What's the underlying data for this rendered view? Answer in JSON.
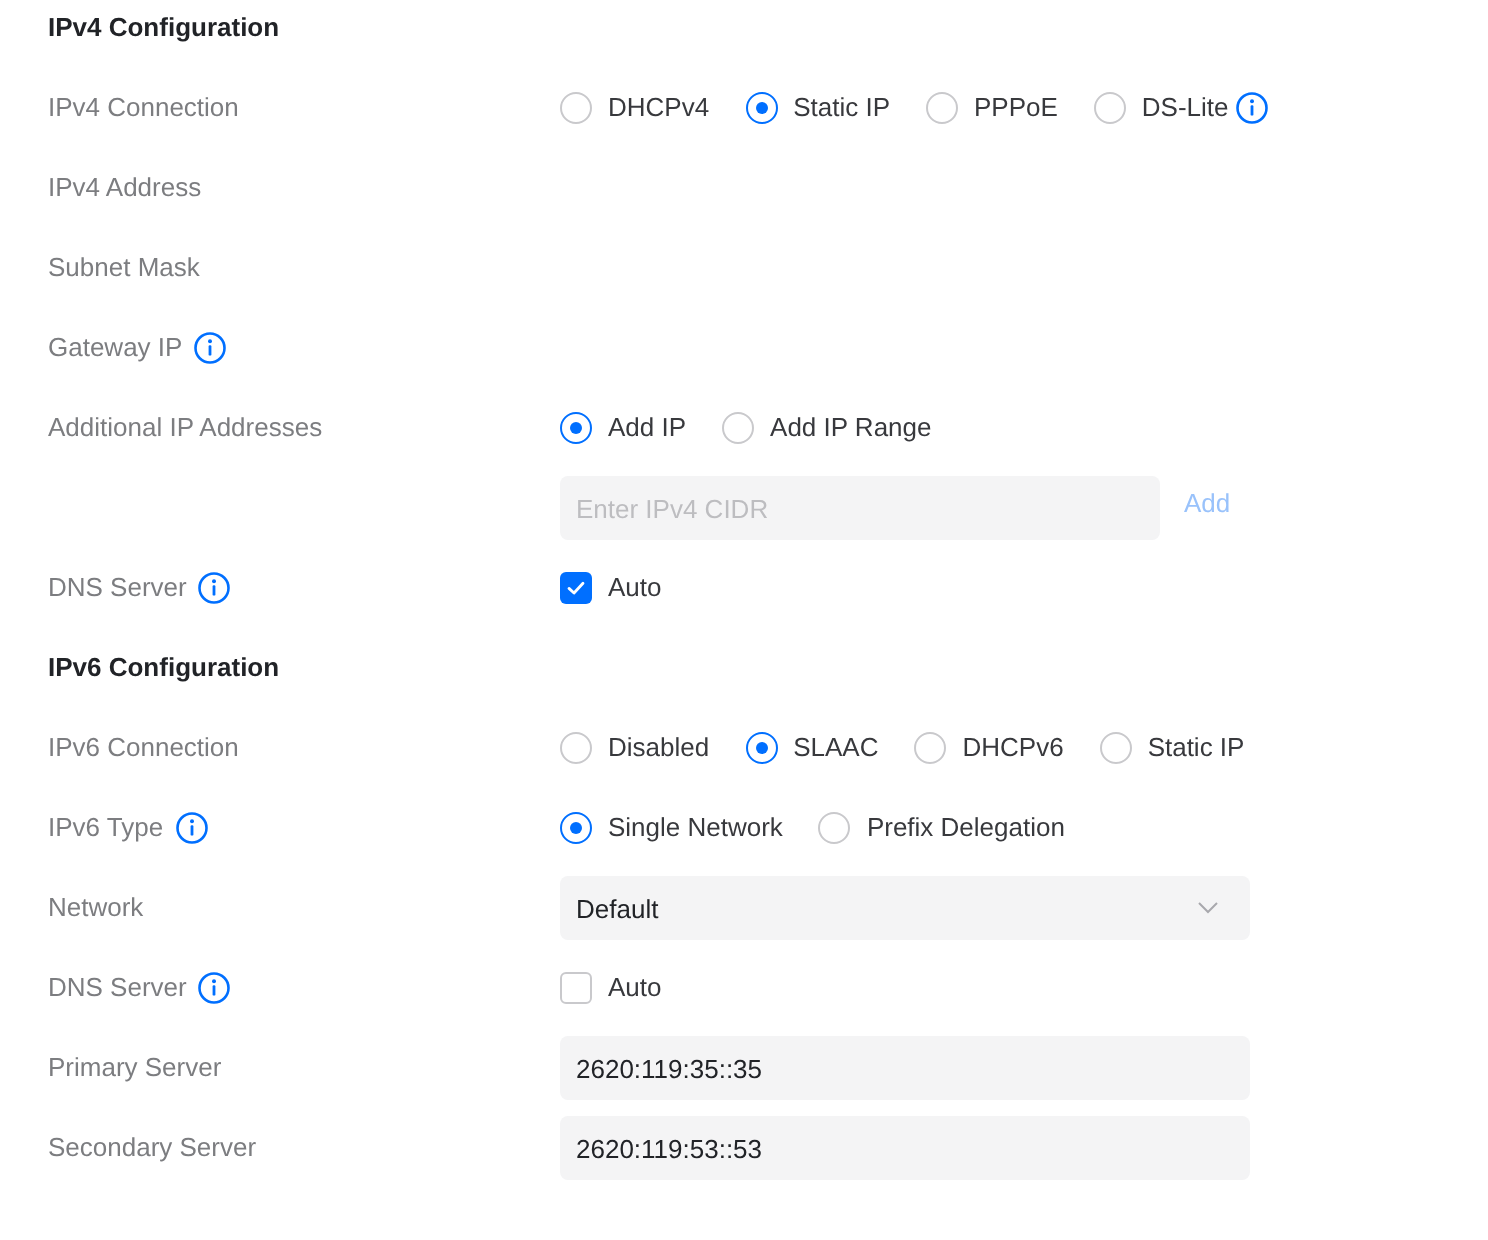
{
  "sections": [
    {
      "title": "IPv4 Configuration",
      "rows": [
        {
          "kind": "radio",
          "label": "IPv4 Connection",
          "info": false,
          "options": [
            {
              "label": "DHCPv4",
              "selected": false,
              "info": false
            },
            {
              "label": "Static IP",
              "selected": true,
              "info": false
            },
            {
              "label": "PPPoE",
              "selected": false,
              "info": false
            },
            {
              "label": "DS-Lite",
              "selected": false,
              "info": true
            }
          ]
        },
        {
          "kind": "blank",
          "label": "IPv4 Address",
          "info": false
        },
        {
          "kind": "blank",
          "label": "Subnet Mask",
          "info": false
        },
        {
          "kind": "blank",
          "label": "Gateway IP",
          "info": true
        },
        {
          "kind": "radio",
          "label": "Additional IP Addresses",
          "info": false,
          "options": [
            {
              "label": "Add IP",
              "selected": true,
              "info": false
            },
            {
              "label": "Add IP Range",
              "selected": false,
              "info": false
            }
          ]
        },
        {
          "kind": "input_add",
          "placeholder": "Enter IPv4 CIDR",
          "button": "Add",
          "button_disabled": true
        },
        {
          "kind": "checkbox",
          "label": "DNS Server",
          "info": true,
          "option": {
            "label": "Auto",
            "checked": true
          }
        }
      ]
    },
    {
      "title": "IPv6 Configuration",
      "rows": [
        {
          "kind": "radio",
          "label": "IPv6 Connection",
          "info": false,
          "options": [
            {
              "label": "Disabled",
              "selected": false,
              "info": false
            },
            {
              "label": "SLAAC",
              "selected": true,
              "info": false
            },
            {
              "label": "DHCPv6",
              "selected": false,
              "info": false
            },
            {
              "label": "Static IP",
              "selected": false,
              "info": false
            }
          ]
        },
        {
          "kind": "radio",
          "label": "IPv6 Type",
          "info": true,
          "options": [
            {
              "label": "Single Network",
              "selected": true,
              "info": false
            },
            {
              "label": "Prefix Delegation",
              "selected": false,
              "info": false
            }
          ]
        },
        {
          "kind": "select",
          "label": "Network",
          "info": false,
          "value": "Default"
        },
        {
          "kind": "checkbox",
          "label": "DNS Server",
          "info": true,
          "option": {
            "label": "Auto",
            "checked": false
          }
        },
        {
          "kind": "input",
          "label": "Primary Server",
          "info": false,
          "value": "2620:119:35::35"
        },
        {
          "kind": "input",
          "label": "Secondary Server",
          "info": false,
          "value": "2620:119:53::53"
        }
      ]
    }
  ]
}
